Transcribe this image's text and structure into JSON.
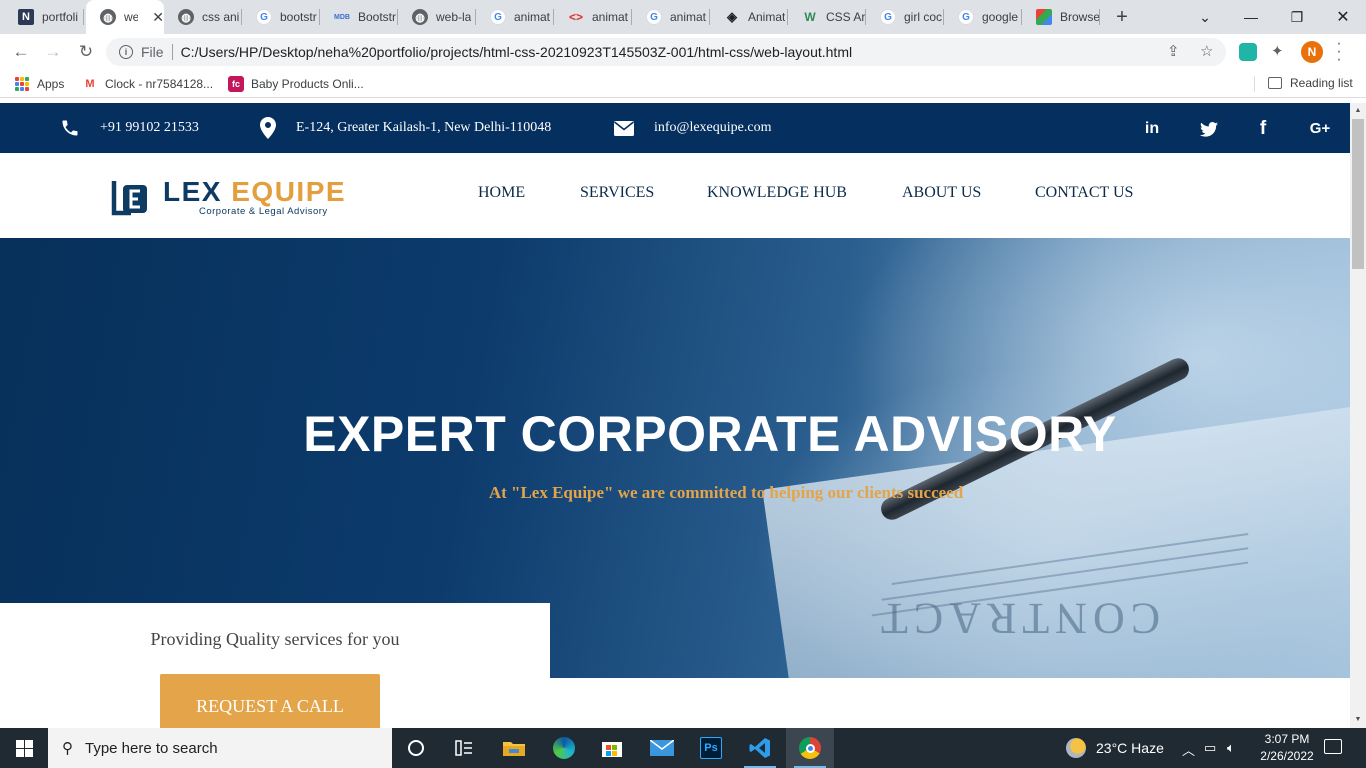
{
  "browser": {
    "tabs": [
      {
        "label": "portfoli",
        "icon": "notion-icon"
      },
      {
        "label": "wel",
        "icon": "globe-icon",
        "active": true
      },
      {
        "label": "css ani",
        "icon": "globe-icon"
      },
      {
        "label": "bootstr",
        "icon": "google-icon"
      },
      {
        "label": "Bootstr",
        "icon": "mdb-icon"
      },
      {
        "label": "web-la",
        "icon": "globe-icon"
      },
      {
        "label": "animat",
        "icon": "google-icon"
      },
      {
        "label": "animat",
        "icon": "code-icon"
      },
      {
        "label": "animat",
        "icon": "google-icon"
      },
      {
        "label": "Animat",
        "icon": "animista-icon"
      },
      {
        "label": "CSS Ar",
        "icon": "w3schools-icon"
      },
      {
        "label": "girl coc",
        "icon": "google-icon"
      },
      {
        "label": "google",
        "icon": "google-icon"
      },
      {
        "label": "Browse",
        "icon": "browse-icon"
      }
    ],
    "new_tab_symbol": "+",
    "address": {
      "scheme": "File",
      "url": "C:/Users/HP/Desktop/neha%20portfolio/projects/html-css-20210923T145503Z-001/html-css/web-layout.html"
    },
    "profile_initial": "N",
    "bookmarks": [
      {
        "label": "Apps",
        "icon": "apps-grid-icon"
      },
      {
        "label": "Clock - nr7584128...",
        "icon": "gmail-icon"
      },
      {
        "label": "Baby Products Onli...",
        "icon": "firstcry-icon"
      }
    ],
    "reading_list": "Reading list"
  },
  "site": {
    "topbar": {
      "phone": "+91 99102 21533",
      "address": "E-124, Greater Kailash-1, New Delhi-110048",
      "email": "info@lexequipe.com",
      "social": [
        {
          "label": "in",
          "icon": "linkedin-icon"
        },
        {
          "label": "",
          "icon": "twitter-icon"
        },
        {
          "label": "f",
          "icon": "facebook-icon"
        },
        {
          "label": "G+",
          "icon": "google-plus-icon"
        }
      ]
    },
    "logo": {
      "word_1": "LEX",
      "word_2": "EQUIPE",
      "tagline": "Corporate & Legal Advisory"
    },
    "nav": [
      "HOME",
      "SERVICES",
      "KNOWLEDGE HUB",
      "ABOUT US",
      "CONTACT US"
    ],
    "hero": {
      "title": "EXPERT CORPORATE ADVISORY",
      "subtitle": "At \"Lex Equipe\" we are committed to helping our clients succeed",
      "image_text": "CONTRACT"
    },
    "card": {
      "text": "Providing Quality services for you",
      "button": "REQUEST A CALL"
    }
  },
  "taskbar": {
    "search_placeholder": "Type here to search",
    "apps": [
      "task-view-icon",
      "widgets-icon",
      "file-explorer-icon",
      "edge-icon",
      "store-icon",
      "mail-icon",
      "photoshop-icon",
      "vscode-icon",
      "chrome-icon"
    ],
    "weather": "23°C  Haze",
    "time": "3:07 PM",
    "date": "2/26/2022"
  },
  "colors": {
    "brand_navy": "#042f5e",
    "brand_gold": "#e4a449"
  }
}
